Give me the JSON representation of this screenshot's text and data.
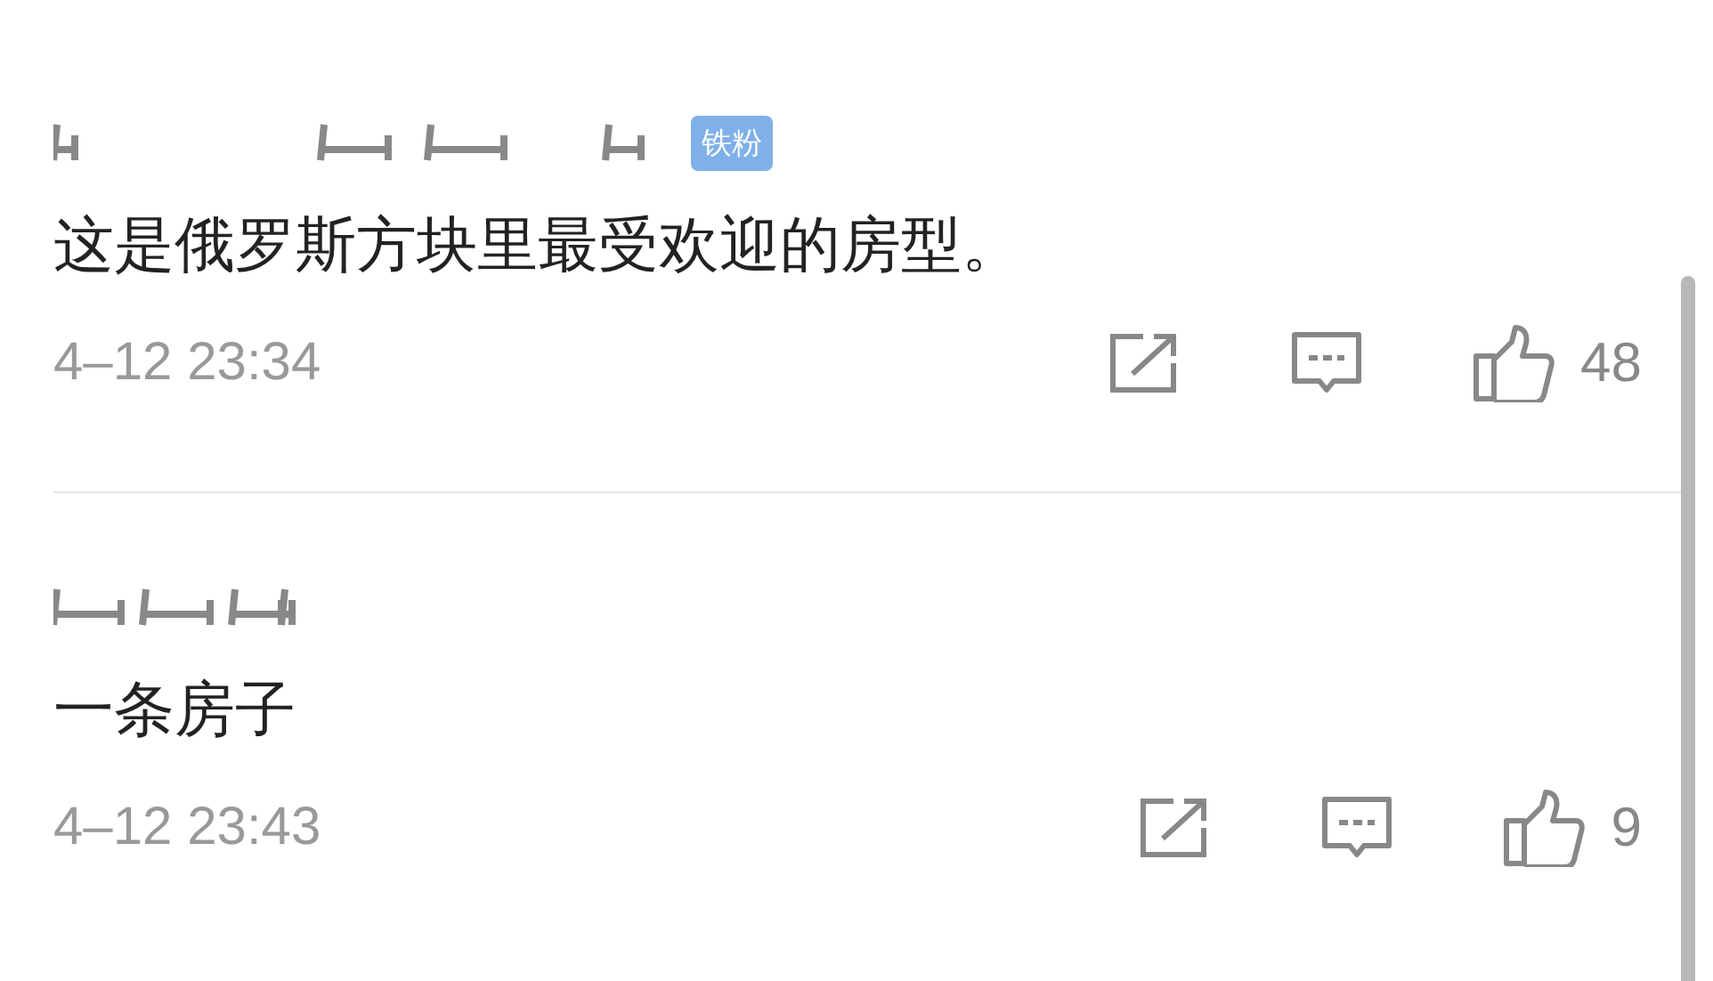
{
  "comments": [
    {
      "badge": "铁粉",
      "text": "这是俄罗斯方块里最受欢迎的房型。",
      "time": "4–12 23:34",
      "likes": "48"
    },
    {
      "text": "一条房子",
      "time": "4–12 23:43",
      "likes": "9"
    }
  ]
}
